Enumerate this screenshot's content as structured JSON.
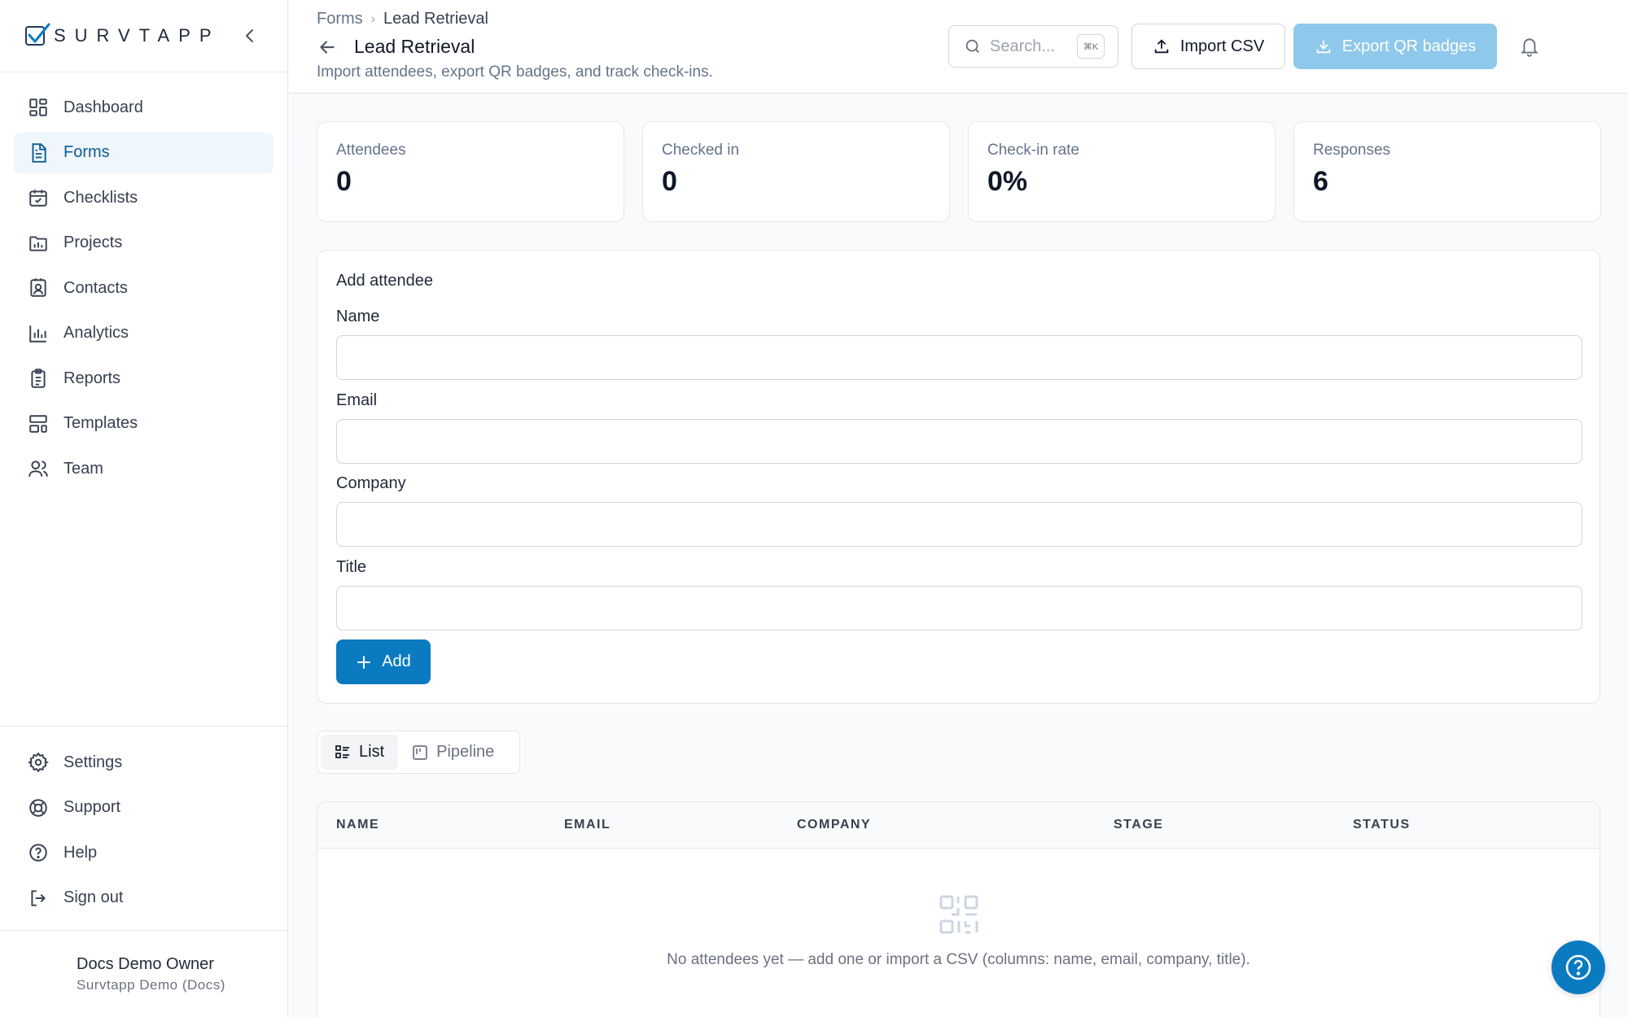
{
  "brand": {
    "name": "SURVTAPP",
    "accent": "#0b7bc1"
  },
  "sidebar": {
    "items": [
      {
        "label": "Dashboard",
        "icon": "dashboard-icon",
        "active": false
      },
      {
        "label": "Forms",
        "icon": "form-document-icon",
        "active": true
      },
      {
        "label": "Checklists",
        "icon": "calendar-check-icon",
        "active": false
      },
      {
        "label": "Projects",
        "icon": "folder-chart-icon",
        "active": false
      },
      {
        "label": "Contacts",
        "icon": "contact-card-icon",
        "active": false
      },
      {
        "label": "Analytics",
        "icon": "bar-chart-icon",
        "active": false
      },
      {
        "label": "Reports",
        "icon": "clipboard-list-icon",
        "active": false
      },
      {
        "label": "Templates",
        "icon": "layout-template-icon",
        "active": false
      },
      {
        "label": "Team",
        "icon": "users-icon",
        "active": false
      }
    ],
    "bottom_items": [
      {
        "label": "Settings",
        "icon": "gear-icon"
      },
      {
        "label": "Support",
        "icon": "lifebuoy-icon"
      },
      {
        "label": "Help",
        "icon": "question-circle-icon"
      },
      {
        "label": "Sign out",
        "icon": "sign-out-icon"
      }
    ],
    "user": {
      "name": "Docs Demo Owner",
      "org": "Survtapp Demo (Docs)"
    }
  },
  "header": {
    "breadcrumb": [
      "Forms",
      "Lead Retrieval"
    ],
    "title": "Lead Retrieval",
    "subtitle": "Import attendees, export QR badges, and track check-ins.",
    "search_placeholder": "Search...",
    "search_shortcut": "⌘K",
    "import_label": "Import CSV",
    "export_label": "Export QR badges"
  },
  "stats": [
    {
      "label": "Attendees",
      "value": "0"
    },
    {
      "label": "Checked in",
      "value": "0"
    },
    {
      "label": "Check-in rate",
      "value": "0%"
    },
    {
      "label": "Responses",
      "value": "6"
    }
  ],
  "add_form": {
    "title": "Add attendee",
    "fields": [
      {
        "label": "Name",
        "value": ""
      },
      {
        "label": "Email",
        "value": ""
      },
      {
        "label": "Company",
        "value": ""
      },
      {
        "label": "Title",
        "value": ""
      }
    ],
    "add_label": "Add"
  },
  "view_toggle": {
    "list": "List",
    "pipeline": "Pipeline",
    "selected": "List"
  },
  "table": {
    "columns": [
      "NAME",
      "EMAIL",
      "COMPANY",
      "STAGE",
      "STATUS"
    ],
    "rows": [],
    "empty_text": "No attendees yet — add one or import a CSV (columns: name, email, company, title)."
  }
}
